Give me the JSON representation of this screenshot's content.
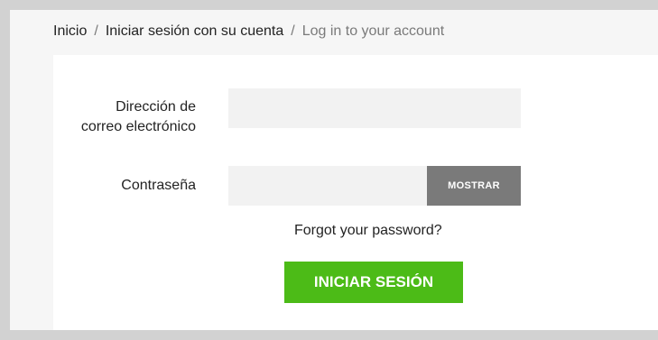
{
  "breadcrumb": {
    "items": [
      {
        "label": "Inicio"
      },
      {
        "label": "Iniciar sesión con su cuenta"
      },
      {
        "label": "Log in to your account"
      }
    ],
    "separator": "/"
  },
  "login_form": {
    "email": {
      "label_line1": "Dirección de",
      "label_line2": "correo electrónico",
      "value": ""
    },
    "password": {
      "label": "Contraseña",
      "value": "",
      "show_button_label": "MOSTRAR"
    },
    "forgot_password_label": "Forgot your password?",
    "submit_label": "INICIAR SESIÓN"
  },
  "colors": {
    "submit_green": "#4cbb17",
    "show_button_gray": "#7a7a7a",
    "input_background": "#f2f2f2"
  }
}
